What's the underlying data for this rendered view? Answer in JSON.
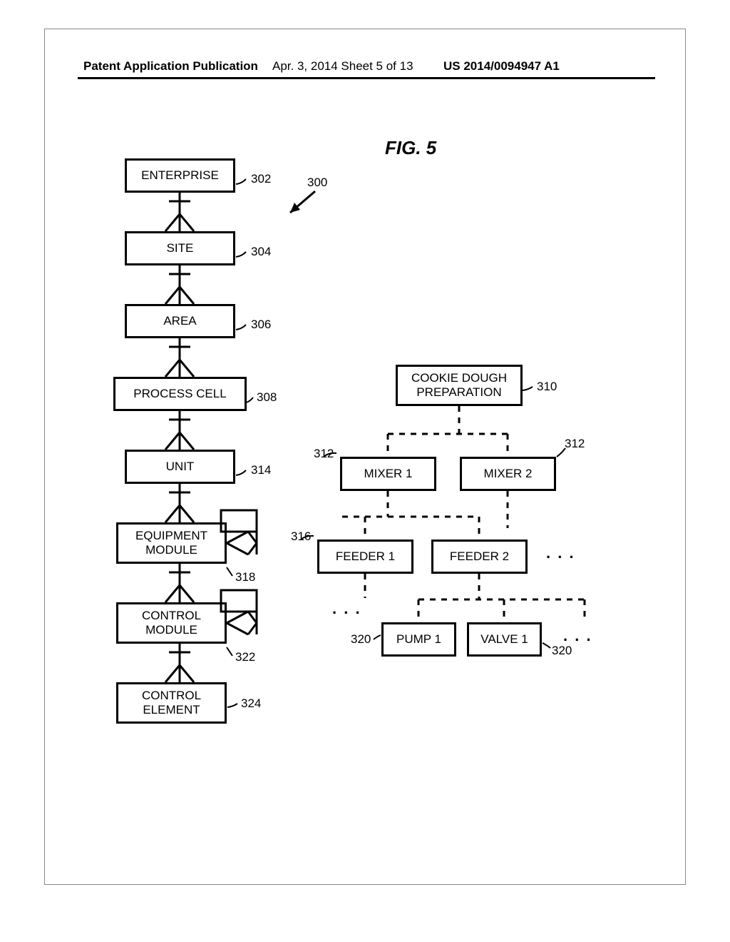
{
  "header": {
    "left": "Patent Application Publication",
    "mid": "Apr. 3, 2014  Sheet 5 of 13",
    "right": "US 2014/0094947 A1"
  },
  "figure": {
    "title": "FIG. 5",
    "ref300": "300"
  },
  "left_hierarchy": [
    {
      "label": "ENTERPRISE",
      "ref": "302"
    },
    {
      "label": "SITE",
      "ref": "304"
    },
    {
      "label": "AREA",
      "ref": "306"
    },
    {
      "label": "PROCESS CELL",
      "ref": "308"
    },
    {
      "label": "UNIT",
      "ref": "314"
    },
    {
      "label": "EQUIPMENT\nMODULE",
      "ref": "318"
    },
    {
      "label": "CONTROL\nMODULE",
      "ref": "322"
    },
    {
      "label": "CONTROL\nELEMENT",
      "ref": "324"
    }
  ],
  "right_tree": {
    "root": {
      "label": "COOKIE DOUGH\nPREPARATION",
      "ref": "310"
    },
    "mixers": {
      "a": "MIXER 1",
      "b": "MIXER 2",
      "ref": "312"
    },
    "feeders": {
      "a": "FEEDER 1",
      "b": "FEEDER 2",
      "ref": "316"
    },
    "leaves": {
      "a": "PUMP 1",
      "b": "VALVE 1",
      "ref": "320"
    },
    "ellipsis": ". . ."
  }
}
